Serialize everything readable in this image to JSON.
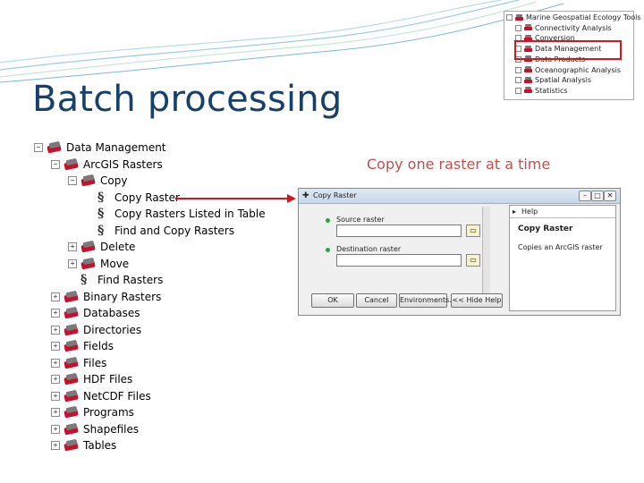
{
  "slide": {
    "title": "Batch processing",
    "caption": "Copy one raster at a time"
  },
  "tree": [
    {
      "label": "Data Management",
      "level": 0,
      "expander": "−",
      "icon": "toolbox-icon"
    },
    {
      "label": "ArcGIS Rasters",
      "level": 1,
      "expander": "−",
      "icon": "toolbox-icon"
    },
    {
      "label": "Copy",
      "level": 2,
      "expander": "−",
      "icon": "toolbox-icon"
    },
    {
      "label": "Copy Raster",
      "level": 3,
      "expander": "",
      "icon": "script-icon"
    },
    {
      "label": "Copy Rasters Listed in Table",
      "level": 3,
      "expander": "",
      "icon": "script-icon"
    },
    {
      "label": "Find and Copy Rasters",
      "level": 3,
      "expander": "",
      "icon": "script-icon"
    },
    {
      "label": "Delete",
      "level": 2,
      "expander": "+",
      "icon": "toolbox-icon"
    },
    {
      "label": "Move",
      "level": 2,
      "expander": "+",
      "icon": "toolbox-icon"
    },
    {
      "label": "Find Rasters",
      "level": 2,
      "expander": "",
      "icon": "script-icon"
    },
    {
      "label": "Binary Rasters",
      "level": 1,
      "expander": "+",
      "icon": "toolbox-icon"
    },
    {
      "label": "Databases",
      "level": 1,
      "expander": "+",
      "icon": "toolbox-icon"
    },
    {
      "label": "Directories",
      "level": 1,
      "expander": "+",
      "icon": "toolbox-icon"
    },
    {
      "label": "Fields",
      "level": 1,
      "expander": "+",
      "icon": "toolbox-icon"
    },
    {
      "label": "Files",
      "level": 1,
      "expander": "+",
      "icon": "toolbox-icon"
    },
    {
      "label": "HDF Files",
      "level": 1,
      "expander": "+",
      "icon": "toolbox-icon"
    },
    {
      "label": "NetCDF Files",
      "level": 1,
      "expander": "+",
      "icon": "toolbox-icon"
    },
    {
      "label": "Programs",
      "level": 1,
      "expander": "+",
      "icon": "toolbox-icon"
    },
    {
      "label": "Shapefiles",
      "level": 1,
      "expander": "+",
      "icon": "toolbox-icon"
    },
    {
      "label": "Tables",
      "level": 1,
      "expander": "+",
      "icon": "toolbox-icon"
    }
  ],
  "toolbox_overview": [
    {
      "label": "Marine Geospatial Ecology Tools",
      "level": 0
    },
    {
      "label": "Connectivity Analysis",
      "level": 1
    },
    {
      "label": "Conversion",
      "level": 1
    },
    {
      "label": "Data Management",
      "level": 1
    },
    {
      "label": "Data Products",
      "level": 1
    },
    {
      "label": "Oceanographic Analysis",
      "level": 1
    },
    {
      "label": "Spatial Analysis",
      "level": 1
    },
    {
      "label": "Statistics",
      "level": 1
    }
  ],
  "dialog": {
    "title": "Copy Raster",
    "source_label": "Source raster",
    "destination_label": "Destination raster",
    "buttons": {
      "ok": "OK",
      "cancel": "Cancel",
      "environments": "Environments...",
      "hide_help": "<< Hide Help"
    },
    "help_tab": "Help",
    "help_title": "Copy Raster",
    "help_text": "Copies an ArcGIS raster"
  },
  "colors": {
    "title": "#17406d",
    "caption": "#c0504d",
    "highlight": "#d0191e"
  }
}
